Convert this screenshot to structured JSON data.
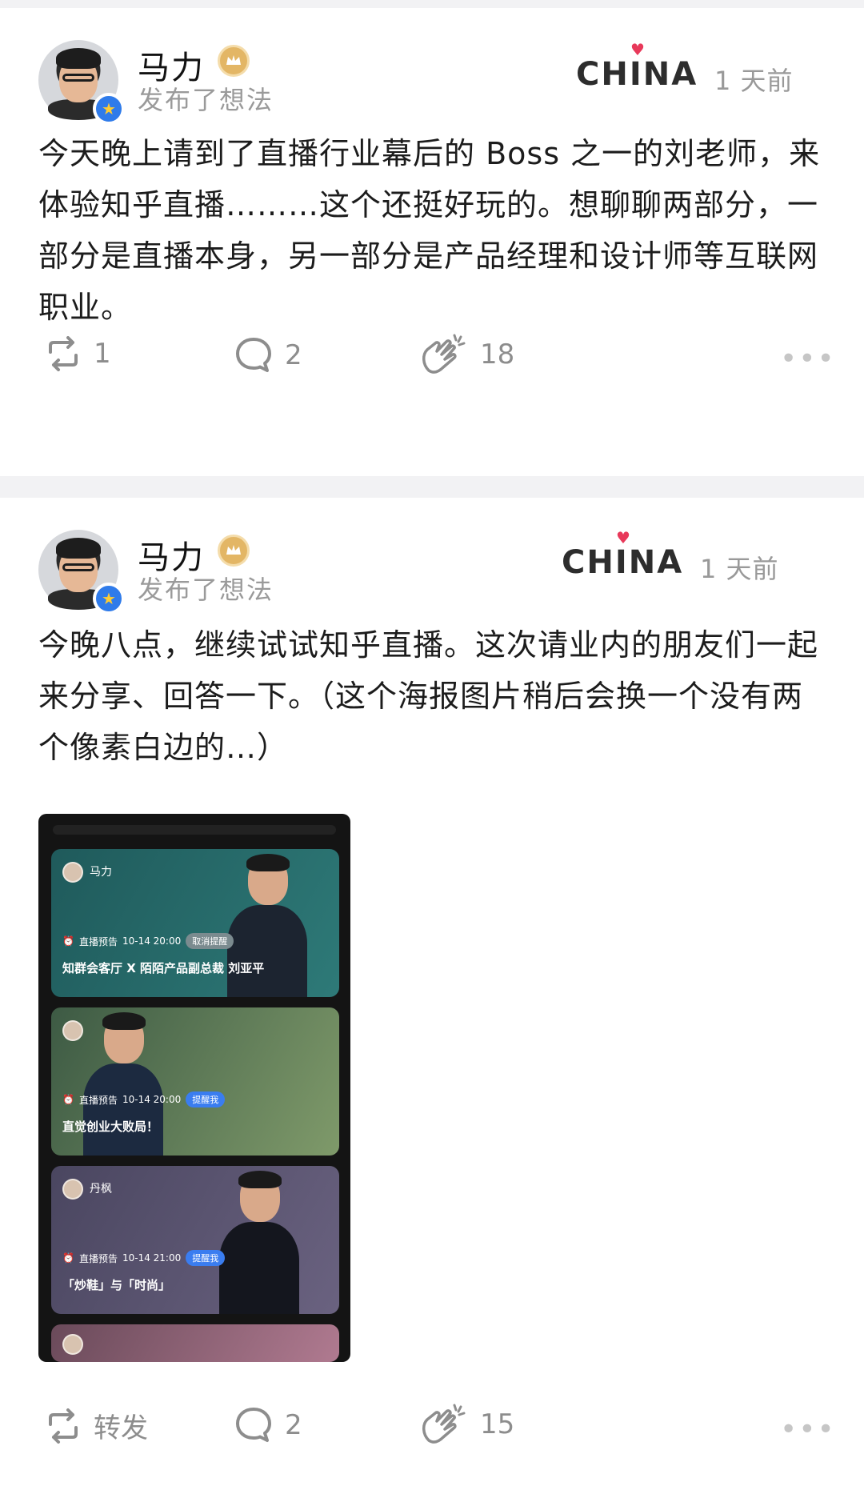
{
  "posts": [
    {
      "author": "马力",
      "action": "发布了想法",
      "logo": "CHINA",
      "time": "1 天前",
      "content": "今天晚上请到了直播行业幕后的 Boss 之一的刘老师，来体验知乎直播………这个还挺好玩的。想聊聊两部分，一部分是直播本身，另一部分是产品经理和设计师等互联网职业。",
      "repost_count": "1",
      "comment_count": "2",
      "applause_count": "18",
      "more": "•••"
    },
    {
      "author": "马力",
      "action": "发布了想法",
      "logo": "CHINA",
      "time": "1 天前",
      "content": "今晚八点，继续试试知乎直播。这次请业内的朋友们一起来分享、回答一下。（这个海报图片稍后会换一个没有两个像素白边的…）",
      "repost_label": "转发",
      "comment_count": "2",
      "applause_count": "15",
      "more": "•••",
      "poster": {
        "cards": [
          {
            "host": "马力",
            "meta_label": "直播预告",
            "datetime": "10-14 20:00",
            "tag": "取消提醒",
            "title": "知群会客厅 X 陌陌产品副总裁 刘亚平"
          },
          {
            "host": "",
            "meta_label": "直播预告",
            "datetime": "10-14 20:00",
            "tag": "提醒我",
            "title": "直觉创业大败局！"
          },
          {
            "host": "丹枫",
            "meta_label": "直播预告",
            "datetime": "10-14 21:00",
            "tag": "提醒我",
            "title": "「炒鞋」与「时尚」"
          },
          {
            "host": "",
            "meta_label": "",
            "datetime": "",
            "tag": "",
            "title": ""
          }
        ]
      }
    }
  ],
  "colors": {
    "badge_blue": "#2f7bea",
    "crown_gold": "#e3b665",
    "heart_red": "#e8395a",
    "muted_text": "#9a9a9a",
    "tag_blue": "#3a7df0"
  }
}
